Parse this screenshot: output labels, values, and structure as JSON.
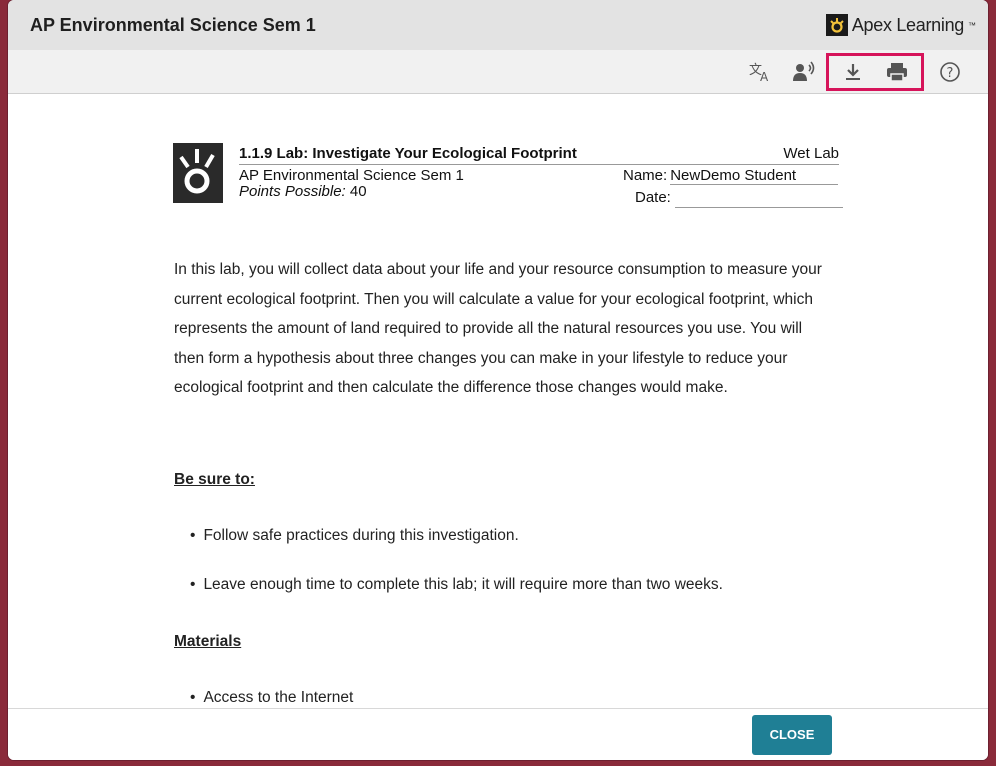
{
  "window": {
    "title": "AP Environmental Science Sem 1"
  },
  "brand": {
    "name": "Apex Learning",
    "trademark": "™"
  },
  "toolbar": {
    "icons": [
      "translate-icon",
      "read-aloud-icon",
      "download-icon",
      "print-icon",
      "help-icon"
    ],
    "highlight_color": "#d6145a"
  },
  "doc": {
    "lab_title": "1.1.9 Lab:  Investigate Your Ecological Footprint",
    "lab_type": "Wet Lab",
    "course": "AP Environmental Science Sem 1",
    "points_label": "Points Possible:",
    "points_value": " 40",
    "name_label": "Name:",
    "name_value": "NewDemo Student",
    "date_label": "Date:",
    "date_value": ""
  },
  "intro": "In this lab, you will collect data about your life and your resource consumption to measure your current ecological footprint. Then you will calculate a value for your ecological footprint, which represents the amount of land required to provide all the natural resources you use. You will then form a hypothesis about three changes you can make in your lifestyle to reduce your ecological footprint and then calculate the difference those changes would make.",
  "sections": {
    "be_sure_to": {
      "heading": "Be sure to:",
      "items": [
        "Follow safe practices during this investigation.",
        "Leave enough time to complete this lab; it will require more than two weeks."
      ]
    },
    "materials": {
      "heading": "Materials",
      "items": [
        "Access to the Internet"
      ]
    }
  },
  "footer": {
    "close_label": "CLOSE",
    "accent": "#1f7f95"
  }
}
